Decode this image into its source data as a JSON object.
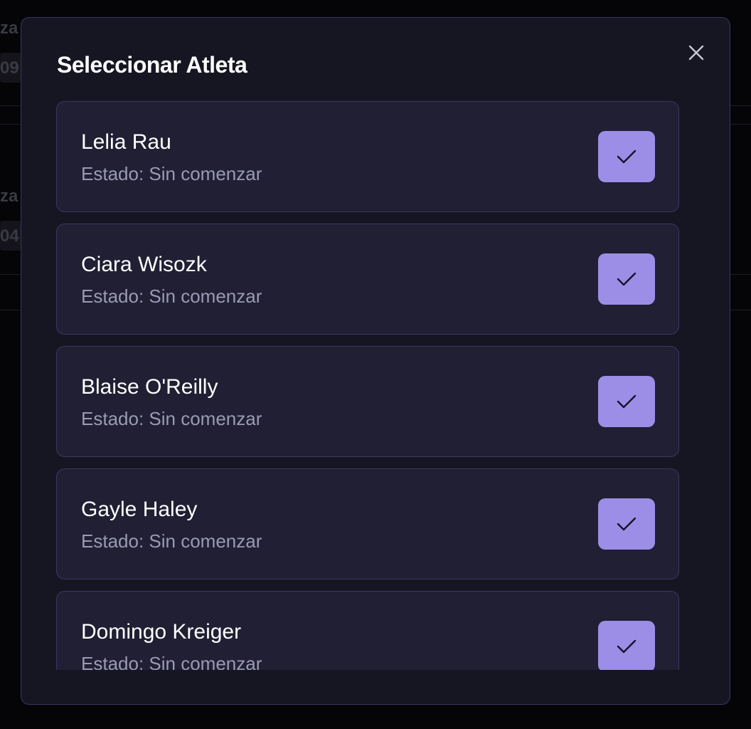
{
  "background": {
    "fragments": [
      "za",
      "09",
      "za",
      "04"
    ]
  },
  "modal": {
    "title": "Seleccionar Atleta",
    "close_icon": "close-icon",
    "accent_color": "#9c8ee6"
  },
  "athletes": [
    {
      "name": "Lelia Rau",
      "status": "Estado: Sin comenzar"
    },
    {
      "name": "Ciara Wisozk",
      "status": "Estado: Sin comenzar"
    },
    {
      "name": "Blaise O'Reilly",
      "status": "Estado: Sin comenzar"
    },
    {
      "name": "Gayle Haley",
      "status": "Estado: Sin comenzar"
    },
    {
      "name": "Domingo Kreiger",
      "status": "Estado: Sin comenzar"
    }
  ]
}
